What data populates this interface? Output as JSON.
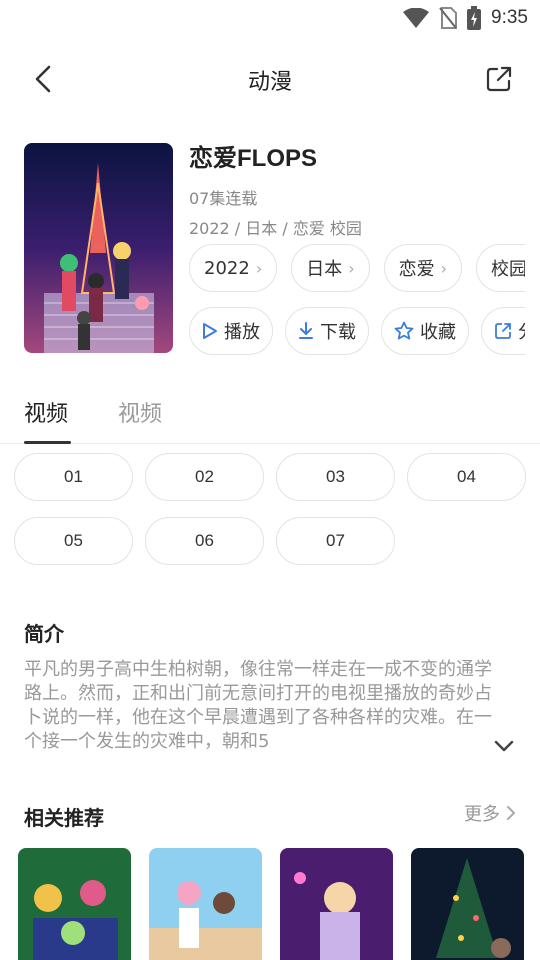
{
  "status": {
    "time": "9:35"
  },
  "header": {
    "title": "动漫"
  },
  "anime": {
    "title": "恋爱FLOPS",
    "episodes": "07集连载",
    "meta": "2022 / 日本 / 恋爱 校园",
    "tags": [
      "2022",
      "日本",
      "恋爱",
      "校园"
    ],
    "actions": [
      {
        "label": "播放",
        "icon": "play-icon"
      },
      {
        "label": "下载",
        "icon": "download-icon"
      },
      {
        "label": "收藏",
        "icon": "star-icon"
      },
      {
        "label": "分享",
        "icon": "share-icon"
      }
    ]
  },
  "tabs": [
    "视频",
    "视频"
  ],
  "episodes": [
    "01",
    "02",
    "03",
    "04",
    "05",
    "06",
    "07"
  ],
  "intro": {
    "title": "简介",
    "text": "平凡的男子高中生柏树朝，像往常一样走在一成不变的通学路上。然而，正和出门前无意间打开的电视里播放的奇妙占卜说的一样，他在这个早晨遭遇到了各种各样的灾难。在一个接一个发生的灾难中，朝和5"
  },
  "recommend": {
    "title": "相关推荐",
    "more": "更多"
  },
  "colors": {
    "accent": "#3b7ddd",
    "text": "#222222",
    "muted": "#999999",
    "border": "#e3e3e3"
  }
}
